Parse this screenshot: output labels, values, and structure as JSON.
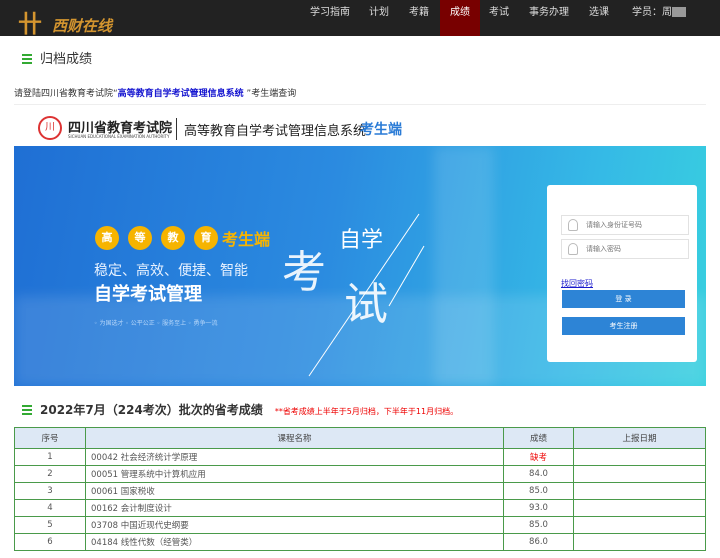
{
  "nav": {
    "logo_text": "西财在线",
    "items": [
      "学习指南",
      "计划",
      "考籍",
      "成绩",
      "考试",
      "事务办理",
      "选课"
    ],
    "active": "成绩",
    "user_label": "学员：周"
  },
  "page_title": "归档成绩",
  "notice": {
    "prefix": "请登陆四川省教育考试院“",
    "link": "高等教育自学考试管理信息系统",
    "suffix": " ”考生端查询"
  },
  "banner": {
    "org_name": "四川省教育考试院",
    "org_en": "SICHUAN EDUCATIONAL EXAMINATION AUTHORITY",
    "system": "高等教育自学考试管理信息系统",
    "system_suffix": "考生端",
    "dots": [
      "高",
      "等",
      "教",
      "育"
    ],
    "dots_suffix": "考生端",
    "slogan": "稳定、高效、便捷、智能",
    "headline": "自学考试管理",
    "tags": "◦ 为国选才 ◦ 公平公正 ◦ 服务至上 ◦ 勇争一流",
    "calli": [
      "自学",
      "考",
      "试"
    ],
    "login": {
      "id_placeholder": "请输入身份证号码",
      "pwd_placeholder": "请输入密码",
      "forgot": "找回密码",
      "login_btn": "登 录",
      "register_btn": "考生注册"
    }
  },
  "section": {
    "title": "2022年7月（224考次）批次的省考成绩",
    "note": "**省考成绩上半年于5月归档，下半年于11月归档。"
  },
  "table": {
    "headers": [
      "序号",
      "课程名称",
      "成绩",
      "上报日期"
    ],
    "rows": [
      [
        "1",
        "00042 社会经济统计学原理",
        "缺考",
        ""
      ],
      [
        "2",
        "00051 管理系统中计算机应用",
        "84.0",
        ""
      ],
      [
        "3",
        "00061 国家税收",
        "85.0",
        ""
      ],
      [
        "4",
        "00162 会计制度设计",
        "93.0",
        ""
      ],
      [
        "5",
        "03708 中国近现代史纲要",
        "85.0",
        ""
      ],
      [
        "6",
        "04184 线性代数（经管类）",
        "86.0",
        ""
      ]
    ]
  },
  "colors": {
    "nav_bg": "#222222",
    "active_bg": "#780000",
    "accent": "#2d84d6",
    "absent": "#ee0000"
  }
}
